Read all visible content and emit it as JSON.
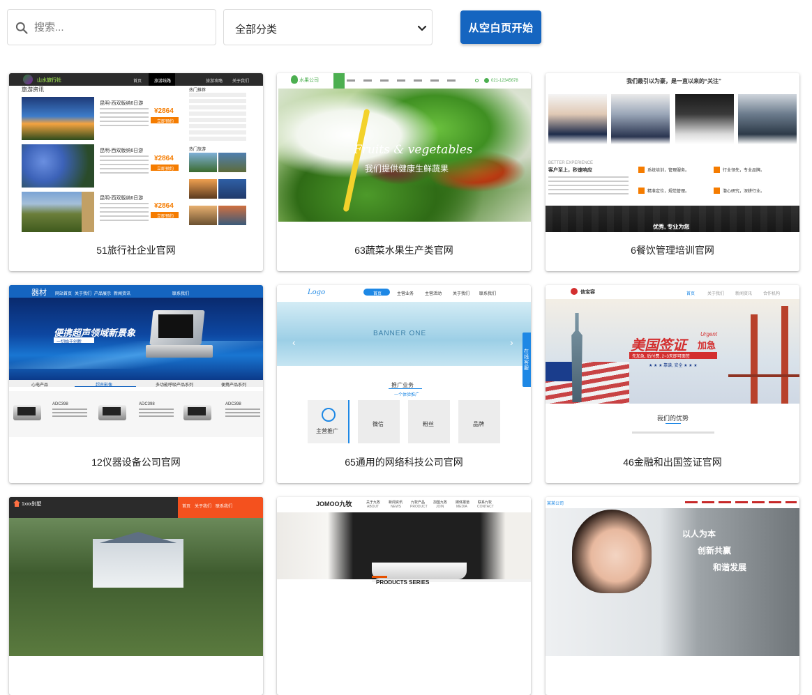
{
  "search": {
    "placeholder": "搜索...",
    "value": ""
  },
  "category_select": {
    "selected": "全部分类"
  },
  "start_button": {
    "label": "从空白页开始"
  },
  "templates": [
    {
      "caption": "51旅行社企业官网",
      "thumb": {
        "nav": [
          "首页",
          "旅游线路",
          "旅游攻略",
          "关于我们"
        ],
        "section_title": "旅游资讯",
        "side_title": "热门推荐",
        "side_title2": "热门旅游",
        "price": "¥2864",
        "price_button": "立即预约",
        "route": "昆明-西双版纳6日游"
      }
    },
    {
      "caption": "63蔬菜水果生产类官网",
      "thumb": {
        "banner_script": "Fruits & vegetables",
        "banner_subtitle": "我们提供健康生鲜蔬果",
        "phone": "021-12345678",
        "logo": "水果公司"
      }
    },
    {
      "caption": "6餐饮管理培训官网",
      "thumb": {
        "headline": "我们最引以为豪，是一直以来的“关注”",
        "left_title": "客户至上，秒速响应",
        "left_en": "BETTER EXPERIENCE",
        "features": [
          "系统培训，管理服务。",
          "行业领先，专业品牌。",
          "精准定位，规范管理。",
          "潜心研究，深耕行业。"
        ],
        "footer": "优秀, 专业为您"
      }
    },
    {
      "caption": "12仪器设备公司官网",
      "thumb": {
        "logo": "器材",
        "nav": [
          "网站首页",
          "关于我们",
          "产品展示",
          "新闻资讯",
          "联系我们"
        ],
        "banner": "便携超声领域新景象",
        "banner_sub": "一切始于创新",
        "tabs": [
          "心电产品",
          "超声影像",
          "多功能呼吸产品系列",
          "便携产品系列"
        ],
        "products": [
          "ADC398",
          "ADC398",
          "ADC398"
        ]
      }
    },
    {
      "caption": "65通用的网络科技公司官网",
      "thumb": {
        "logo": "Logo",
        "nav": [
          "首页",
          "主营业务",
          "主营活动",
          "关于我们",
          "联系我们"
        ],
        "banner": "BANNER ONE",
        "section": "推广业务",
        "section_sub": "一个体验推广",
        "main_tile": "主营推广",
        "tiles": [
          "微信",
          "粉丝",
          "品牌"
        ],
        "side_tab": "在线客服"
      }
    },
    {
      "caption": "46金融和出国签证官网",
      "thumb": {
        "logo": "信宝容",
        "nav": [
          "首页",
          "关于我们",
          "新闻资讯",
          "合作机构"
        ],
        "banner": "美国签证",
        "banner_tag": "加急",
        "banner_en": "Urgent",
        "banner_sub": "先加急, 后付费, 2~3天即可面签",
        "banner_line": "★ ★ ★ 靠谱, 安全 ★ ★ ★",
        "section": "我们的优势"
      }
    },
    {
      "caption": "",
      "thumb": {
        "logo": "1xxx别墅",
        "nav": [
          "首页",
          "关于我们",
          "联系我们"
        ]
      }
    },
    {
      "caption": "",
      "thumb": {
        "logo": "JOMOO九牧",
        "nav": [
          "关于九牧",
          "新闻资讯",
          "九牧产品",
          "加盟九牧",
          "媒体报道",
          "联系九牧"
        ],
        "nav_en": [
          "ABOUT",
          "NEWS",
          "PRODUCT",
          "JOIN",
          "MEDIA",
          "CONTACT"
        ],
        "section": "PRODUCTS SERIES"
      }
    },
    {
      "caption": "",
      "thumb": {
        "logo": "某某公司",
        "slogans": [
          "以人为本",
          "创新共赢",
          "和谐发展"
        ]
      }
    }
  ],
  "colors": {
    "primary_button": "#1565c0",
    "fruit_green": "#4caf50",
    "travel_orange": "#f57c00",
    "instrument_blue": "#1565c0",
    "visa_red": "#d32f2f",
    "jomoo_dark": "#1f1f1f"
  },
  "icons": {
    "search": "search-icon",
    "select_arrow": "chevron-down-icon"
  }
}
